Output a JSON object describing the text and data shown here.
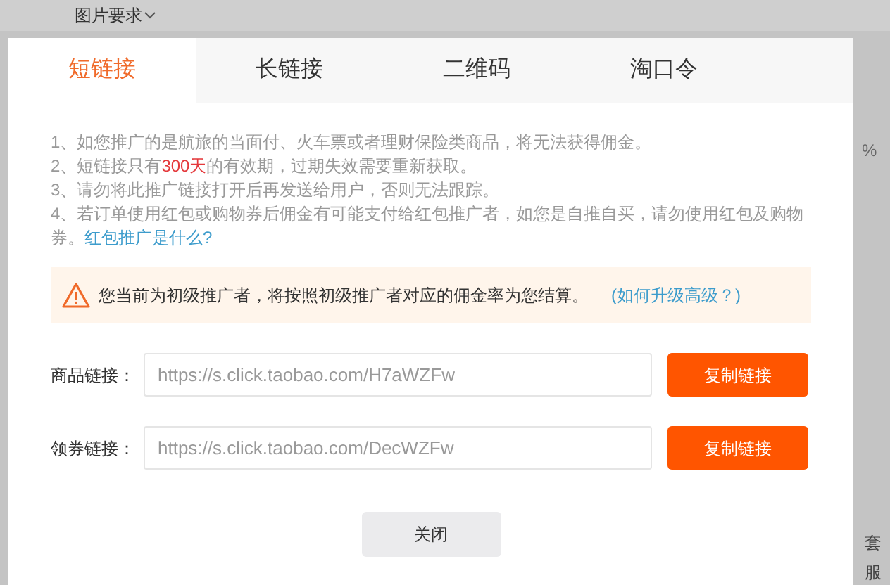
{
  "background": {
    "filter_label": "图片要求",
    "side_texts": [
      "%",
      "套",
      "服"
    ]
  },
  "tabs": [
    {
      "label": "短链接",
      "selected": true
    },
    {
      "label": "长链接",
      "selected": false
    },
    {
      "label": "二维码",
      "selected": false
    },
    {
      "label": "淘口令",
      "selected": false
    }
  ],
  "notes": [
    "1、如您推广的是航旅的当面付、火车票或者理财保险类商品，将无法获得佣金。",
    "2、短链接只有**300天**的有效期，过期失效需要重新获取。",
    "3、请勿将此推广链接打开后再发送给用户，否则无法跟踪。",
    "4、若订单使用红包或购物券后佣金有可能支付给红包推广者，如您是自推自买，请勿使用红包及购物券。"
  ],
  "notes_link": "红包推广是什么?",
  "warning": {
    "text": "您当前为初级推广者，将按照初级推广者对应的佣金率为您结算。",
    "link": "(如何升级高级？)"
  },
  "links": [
    {
      "label": "商品链接：",
      "value": "https://s.click.taobao.com/H7aWZFw",
      "button": "复制链接"
    },
    {
      "label": "领券链接：",
      "value": "https://s.click.taobao.com/DecWZFw",
      "button": "复制链接"
    }
  ],
  "close_button": "关闭"
}
